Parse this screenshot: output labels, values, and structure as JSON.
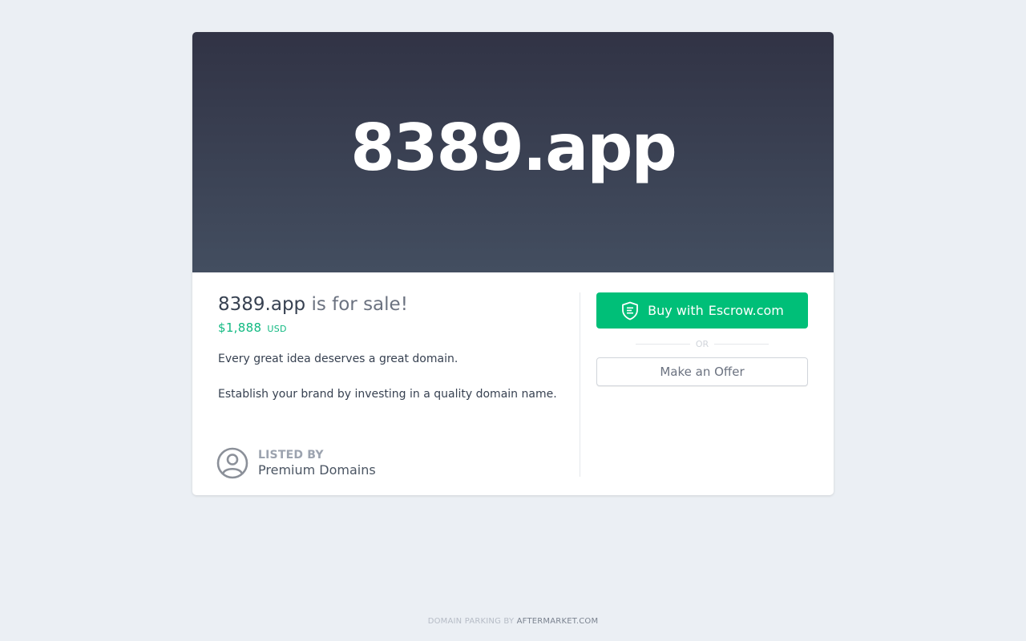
{
  "hero": {
    "domain": "8389.app"
  },
  "listing": {
    "domain": "8389.app",
    "sale_suffix": " is for sale!",
    "price_symbol": "$",
    "price_value": "1,888",
    "currency": "USD",
    "description_1": "Every great idea deserves a great domain.",
    "description_2": "Establish your brand by investing in a quality domain name.",
    "listed_by_label": "LISTED BY",
    "listed_by_name": "Premium Domains"
  },
  "actions": {
    "buy_prefix": "Buy with",
    "buy_brand": "Escrow.com",
    "or_text": "OR",
    "offer_label": "Make an Offer"
  },
  "footer": {
    "prefix": "DOMAIN PARKING BY ",
    "link": "AFTERMARKET.COM"
  },
  "icons": {
    "buy": "shield-icon",
    "seller": "user-avatar-icon"
  },
  "colors": {
    "accent": "#00bf78",
    "price": "#10b981",
    "hero_top": "#313345",
    "hero_bottom": "#434e60",
    "page_bg": "#ebeff4"
  }
}
